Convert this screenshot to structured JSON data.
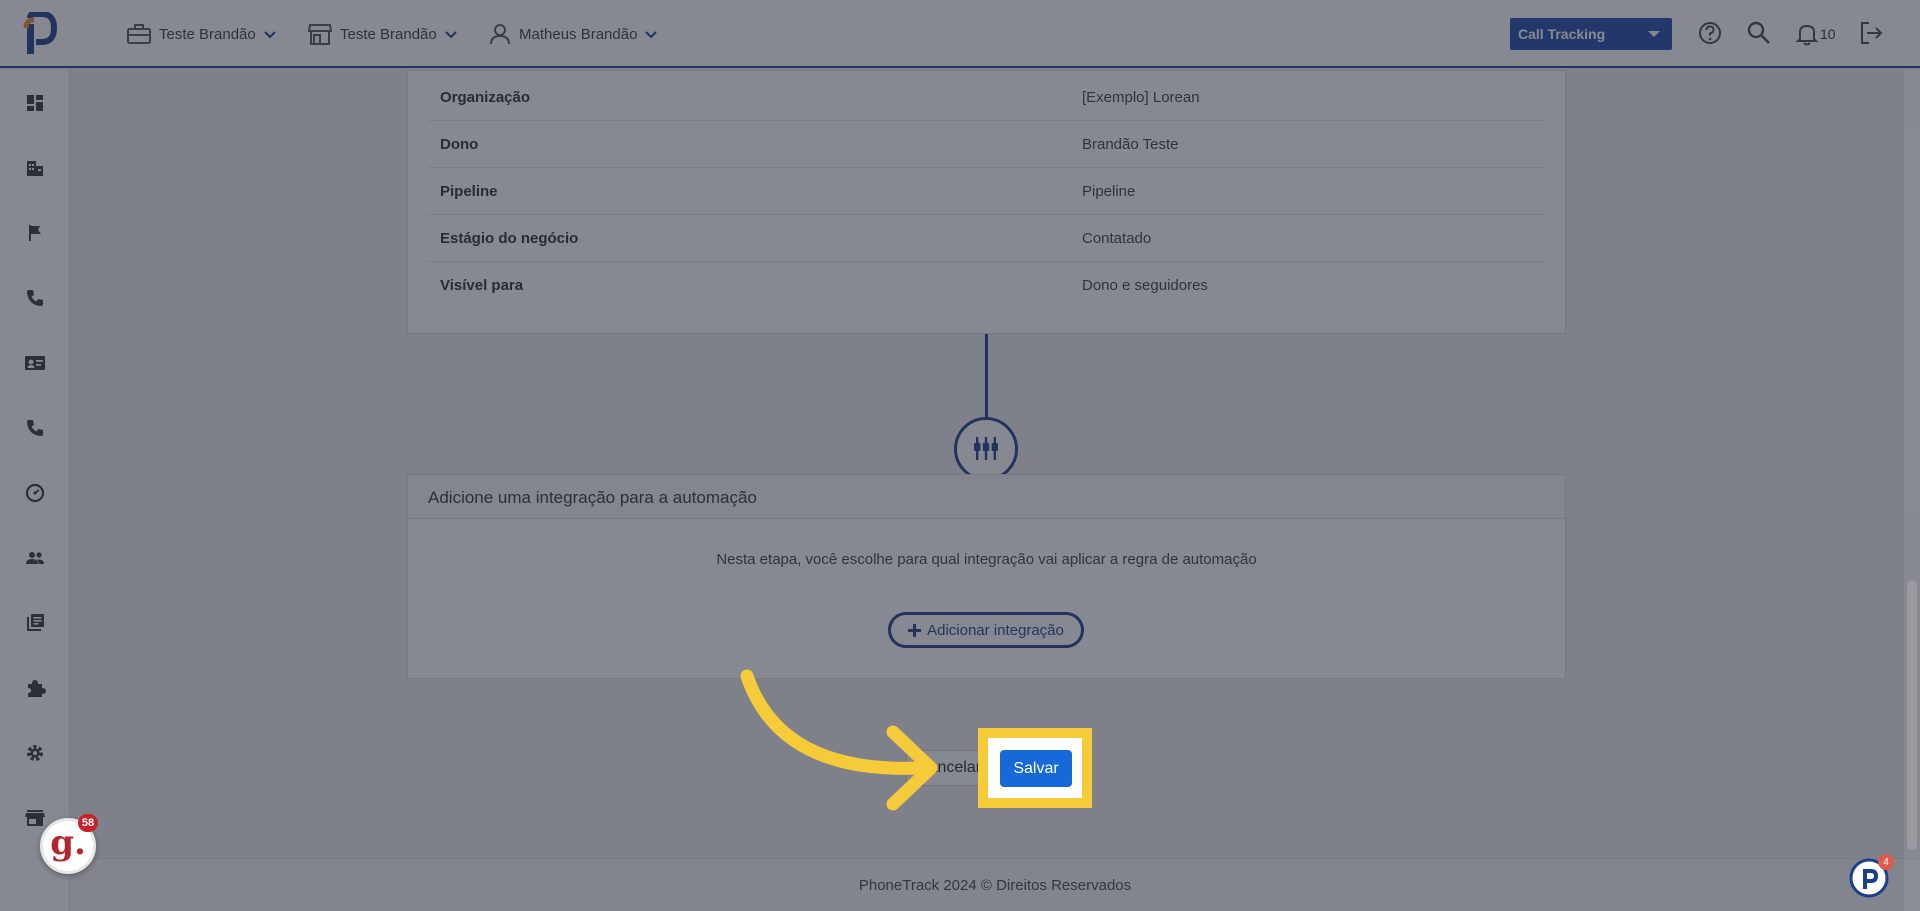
{
  "topbar": {
    "account_label": "Teste Brandão",
    "store_label": "Teste Brandão",
    "user_label": "Matheus Brandão",
    "product_select": "Call Tracking",
    "notifications_count": "10"
  },
  "sidebar": {
    "icons": [
      "dashboard-icon",
      "building-icon",
      "flag-icon",
      "phone-icon",
      "contact-card-icon",
      "phone-icon",
      "speedometer-icon",
      "people-icon",
      "library-icon",
      "puzzle-icon",
      "gear-icon",
      "store-icon"
    ]
  },
  "details": {
    "rows": [
      {
        "label": "Organização",
        "value": "[Exemplo] Lorean"
      },
      {
        "label": "Dono",
        "value": "Brandão Teste"
      },
      {
        "label": "Pipeline",
        "value": "Pipeline"
      },
      {
        "label": "Estágio do negócio",
        "value": "Contatado"
      },
      {
        "label": "Visível para",
        "value": "Dono e seguidores"
      }
    ]
  },
  "integration": {
    "title": "Adicione uma integração para a automação",
    "description": "Nesta etapa, você escolhe para qual integração vai aplicar a regra de automação",
    "add_button": "Adicionar integração"
  },
  "actions": {
    "cancel_label": "Cancelar",
    "save_label": "Salvar"
  },
  "footer": {
    "text": "PhoneTrack 2024 © Direitos Reservados"
  },
  "widgets": {
    "g_badge_letter": "g.",
    "g_badge_count": "58",
    "p_badge_count": "4"
  },
  "colors": {
    "brand_dark": "#1c3f8c",
    "brand_primary": "#1669d6",
    "highlight": "#f6cb3a"
  }
}
